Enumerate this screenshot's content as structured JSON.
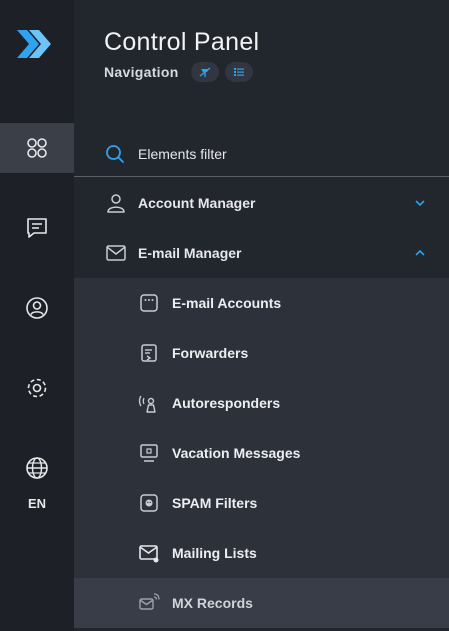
{
  "colors": {
    "accent": "#2ea3f2",
    "rail_bg": "#1d2026",
    "panel_bg": "#22262d",
    "submenu_bg": "#2d313a",
    "highlight_bg": "#383d47"
  },
  "rail": {
    "logo_icon": "brand-double-chevron-icon",
    "items": [
      {
        "icon": "apps-grid-icon",
        "active": true
      },
      {
        "icon": "chat-icon",
        "active": false
      },
      {
        "icon": "user-circle-icon",
        "active": false
      },
      {
        "icon": "settings-gear-icon",
        "active": false
      },
      {
        "icon": "globe-icon",
        "active": false
      }
    ],
    "language": "EN"
  },
  "header": {
    "title": "Control Panel",
    "subtitle": "Navigation",
    "actions": [
      {
        "icon": "pin-off-icon"
      },
      {
        "icon": "list-icon"
      }
    ]
  },
  "menu": {
    "filter": {
      "icon": "search-icon",
      "placeholder": "Elements filter"
    },
    "groups": [
      {
        "label": "Account Manager",
        "icon": "person-icon",
        "expanded": false
      },
      {
        "label": "E-mail Manager",
        "icon": "envelope-icon",
        "expanded": true,
        "items": [
          {
            "label": "E-mail Accounts",
            "icon": "mailbox-icon"
          },
          {
            "label": "Forwarders",
            "icon": "forward-mail-icon"
          },
          {
            "label": "Autoresponders",
            "icon": "broadcast-person-icon"
          },
          {
            "label": "Vacation Messages",
            "icon": "monitor-icon"
          },
          {
            "label": "SPAM Filters",
            "icon": "spam-filter-icon"
          },
          {
            "label": "Mailing Lists",
            "icon": "mailing-list-icon"
          },
          {
            "label": "MX Records",
            "icon": "mx-record-icon",
            "highlighted": true
          }
        ]
      }
    ]
  }
}
